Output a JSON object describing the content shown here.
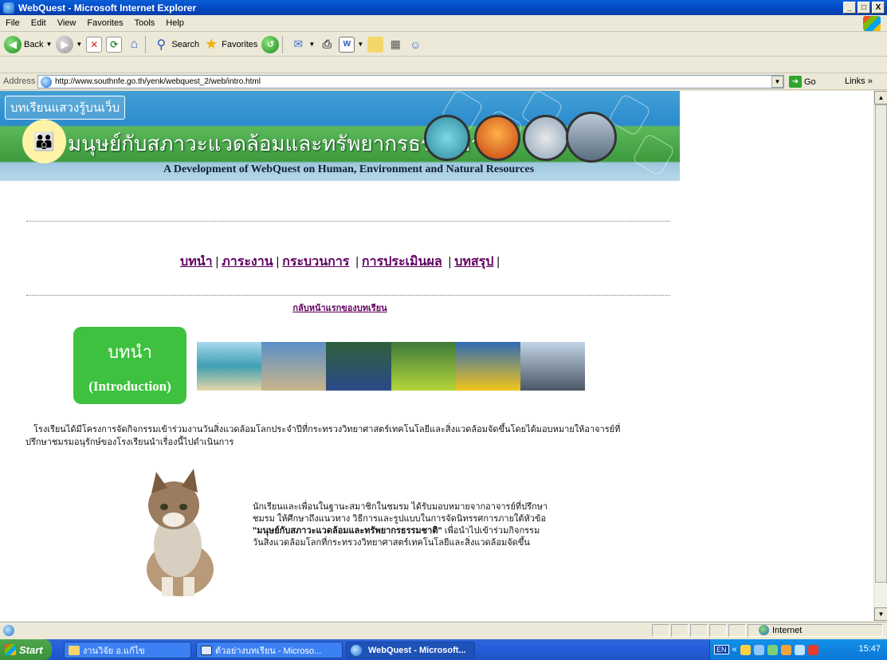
{
  "window": {
    "title": "WebQuest - Microsoft Internet Explorer",
    "min": "_",
    "max": "□",
    "close": "X"
  },
  "menu": [
    "File",
    "Edit",
    "View",
    "Favorites",
    "Tools",
    "Help"
  ],
  "toolbar": {
    "back": "Back",
    "search": "Search",
    "favorites": "Favorites"
  },
  "address": {
    "label": "Address",
    "url": "http://www.southnfe.go.th/yenk/webquest_2/web/intro.html",
    "go": "Go",
    "links": "Links"
  },
  "banner": {
    "tag": "บทเรียนแสวงรู้บนเว็บ",
    "title": "มนุษย์กับสภาวะแวดล้อมและทรัพยากรธรรมชาติ",
    "subtitle": "A Development of WebQuest on Human, Environment and Natural Resources"
  },
  "nav": {
    "intro": "บทนำ",
    "task": "ภาระงาน",
    "process": "กระบวนการ",
    "evaluation": "การประเมินผล",
    "conclusion": "บทสรุป",
    "sep": "|",
    "back": "กลับหน้าแรกของบทเรียน"
  },
  "intro_box": {
    "th": "บทนำ",
    "en": "(Introduction)"
  },
  "para1": "โรงเรียนได้มีโครงการจัดกิจกรรมเข้าร่วมงานวันสิ่งแวดล้อมโลกประจำปีที่กระทรวงวิทยาศาสตร์เทคโนโลยีและสิ่งแวดล้อมจัดขึ้นโดยได้มอบหมายให้อาจารย์ที่ปรึกษาชมรมอนุรักษ์ของโรงเรียนนำเรื่องนี้ไปดำเนินการ",
  "para2": {
    "line1": "นักเรียนและเพื่อนในฐานะสมาชิกในชมรม ได้รับมอบหมายจากอาจารย์ที่ปรึกษา",
    "line2": "ชมรม ให้ศึกษาถึงแนวทาง วิธีการและรูปแบบในการจัดนิทรรศการภายใต้หัวข้อ",
    "bold": "\"มนุษย์กับสภาวะแวดล้อมและทรัพยากรธรรมชาติ\"",
    "line3_rest": " เพื่อนำไปเข้าร่วมกิจกรรม",
    "line4": "วันสิ่งแวดล้อมโลกที่กระทรวงวิทยาศาสตร์เทคโนโลยีและสิ่งแวดล้อมจัดขึ้น"
  },
  "status": {
    "zone": "Internet"
  },
  "taskbar": {
    "start": "Start",
    "tasks": [
      "งานวิจัย อ.แก้ไข",
      "ตัวอย่างบทเรียน - Microso...",
      "WebQuest - Microsoft..."
    ],
    "lang": "EN",
    "clock": "15:47"
  }
}
